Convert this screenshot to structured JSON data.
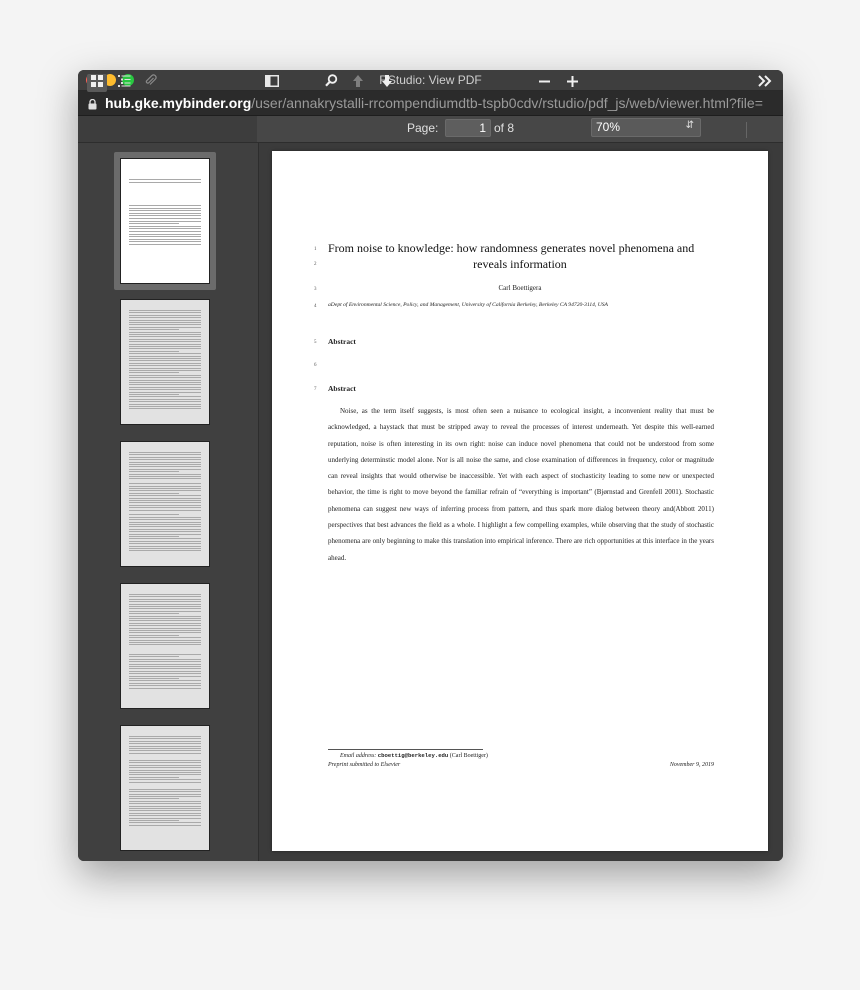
{
  "window": {
    "title": "RStudio: View PDF"
  },
  "address": {
    "host": "hub.gke.mybinder.org",
    "path": "/user/annakrystalli-rrcompendiumdtb-tspb0cdv/rstudio/pdf_js/web/viewer.html?file="
  },
  "toolbar": {
    "page_label": "Page:",
    "page_number": "1",
    "page_of": "of 8",
    "zoom_value": "70%",
    "icons": [
      "thumbnails-icon",
      "outline-icon",
      "attachments-icon",
      "sidebar-toggle-icon",
      "search-icon",
      "previous-page-icon",
      "next-page-icon",
      "zoom-out-icon",
      "zoom-in-icon",
      "tools-chevron-icon"
    ]
  },
  "sidebar": {
    "thumbnail_count": 5,
    "selected_page": 1
  },
  "document": {
    "line_numbers": [
      "1",
      "2",
      "3",
      "4",
      "5",
      "6",
      "7"
    ],
    "title_line1": "From noise to knowledge: how randomness generates novel phenomena and",
    "title_line2": "reveals information",
    "author": "Carl Boettigera",
    "affiliation": "aDept of Environmental Science, Policy, and Management, University of California Berkeley, Berkeley CA 94720-3114, USA",
    "abstract_heading_1": "Abstract",
    "abstract_heading_2": "Abstract",
    "abstract_text": "Noise, as the term itself suggests, is most often seen a nuisance to ecological insight, a inconvenient reality that must be acknowledged, a haystack that must be stripped away to reveal the processes of interest underneath. Yet despite this well-earned reputation, noise is often interesting in its own right: noise can induce novel phenomena that could not be understood from some underlying determinstic model alone. Nor is all noise the same, and close examination of differences in frequency, color or magnitude can reveal insights that would otherwise be inaccessible. Yet with each aspect of stochasticity leading to some new or unexpected behavior, the time is right to move beyond the familiar refrain of “everything is important” (Bjørnstad and Grenfell 2001). Stochastic phenomena can suggest new ways of inferring process from pattern, and thus spark more dialog between theory and(Abbott 2011) perspectives that best advances the field as a whole. I highlight a few compelling examples, while observing that the study of stochastic phenomena are only beginning to make this translation into empirical inference. There are rich opportunities at this interface in the years ahead.",
    "footnote_label": "Email address:",
    "footnote_email": "cboettig@berkeley.edu",
    "footnote_name": "(Carl Boettiger)",
    "preprint": "Preprint submitted to Elsevier",
    "date": "November 9, 2019"
  }
}
